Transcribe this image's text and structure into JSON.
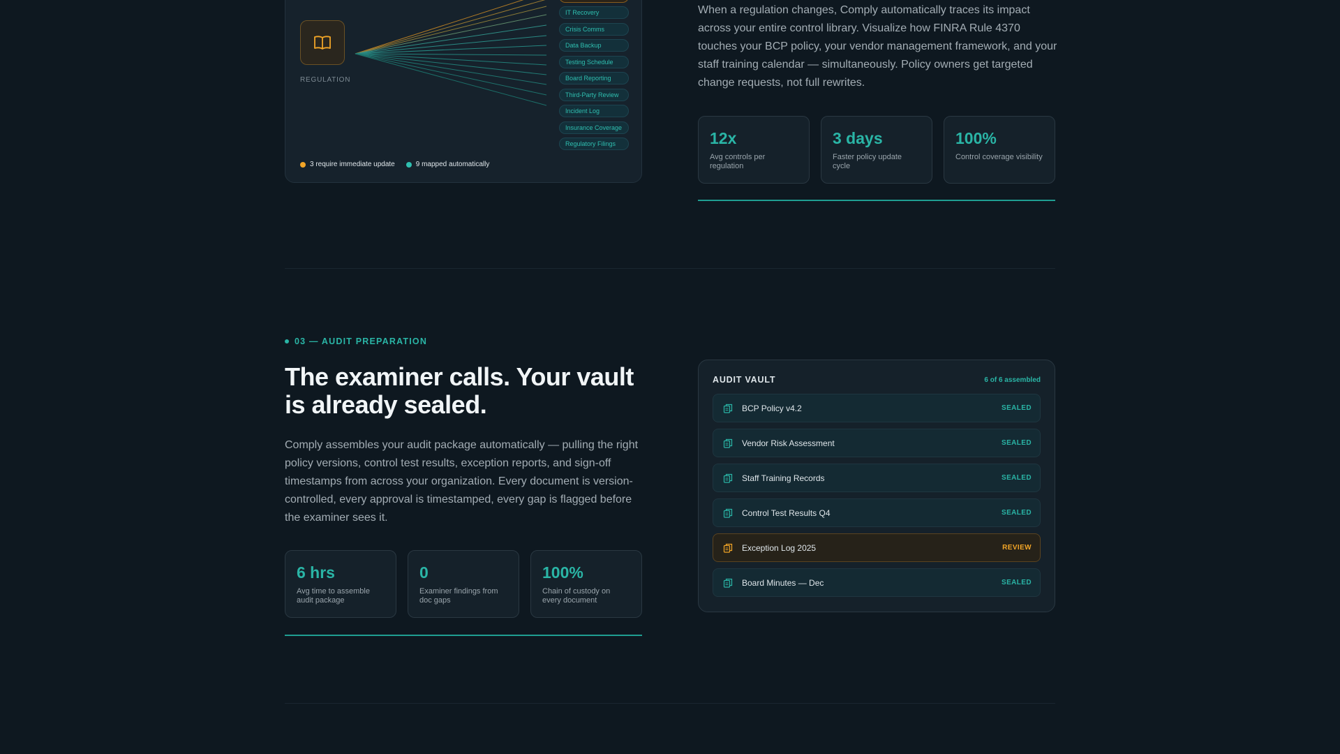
{
  "regulation_map": {
    "regulation_label": "REGULATION",
    "controls": [
      "IT Recovery",
      "Crisis Comms",
      "Data Backup",
      "Testing Schedule",
      "Board Reporting",
      "Third-Party Review",
      "Incident Log",
      "Insurance Coverage",
      "Regulatory Filings"
    ],
    "legend": {
      "immediate": "3 require immediate update",
      "automatic": "9 mapped automatically"
    },
    "colors": {
      "amber": "#f2a527",
      "teal": "#2fbfb0"
    }
  },
  "section_change": {
    "body": "When a regulation changes, Comply automatically traces its impact across your entire control library. Visualize how FINRA Rule 4370 touches your BCP policy, your vendor management framework, and your staff training calendar — simultaneously. Policy owners get targeted change requests, not full rewrites.",
    "stats": [
      {
        "value": "12x",
        "label": "Avg controls per regulation"
      },
      {
        "value": "3 days",
        "label": "Faster policy update cycle"
      },
      {
        "value": "100%",
        "label": "Control coverage visibility"
      }
    ]
  },
  "section_audit": {
    "eyebrow": "03 — AUDIT PREPARATION",
    "headline": "The examiner calls. Your vault is already sealed.",
    "body": "Comply assembles your audit package automatically — pulling the right policy versions, control test results, exception reports, and sign-off timestamps from across your organization. Every document is version-controlled, every approval is timestamped, every gap is flagged before the examiner sees it.",
    "stats": [
      {
        "value": "6 hrs",
        "label": "Avg time to assemble audit package"
      },
      {
        "value": "0",
        "label": "Examiner findings from doc gaps"
      },
      {
        "value": "100%",
        "label": "Chain of custody on every document"
      }
    ]
  },
  "vault": {
    "title": "AUDIT VAULT",
    "count": "6 of 6 assembled",
    "items": [
      {
        "name": "BCP Policy v4.2",
        "status": "SEALED"
      },
      {
        "name": "Vendor Risk Assessment",
        "status": "SEALED"
      },
      {
        "name": "Staff Training Records",
        "status": "SEALED"
      },
      {
        "name": "Control Test Results Q4",
        "status": "SEALED"
      },
      {
        "name": "Exception Log 2025",
        "status": "REVIEW"
      },
      {
        "name": "Board Minutes — Dec",
        "status": "SEALED"
      }
    ],
    "icon": "document-stack-icon"
  },
  "brand_colors": {
    "accent": "#2ab5a6",
    "warning": "#f2a527",
    "background": "#0e1820"
  }
}
